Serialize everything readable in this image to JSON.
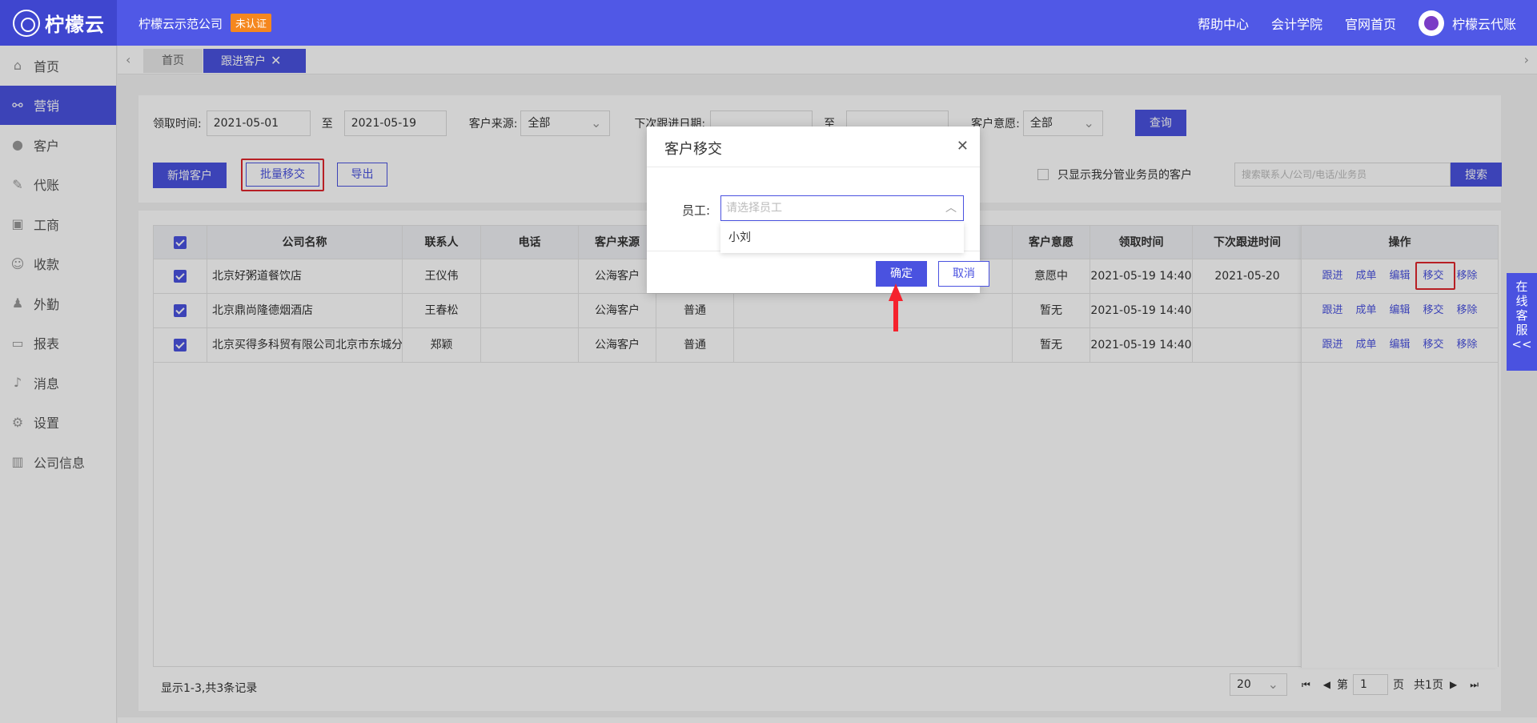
{
  "app": {
    "logo_text": "柠檬云",
    "company": "柠檬云示范公司",
    "cert_badge": "未认证"
  },
  "header": {
    "links": [
      "帮助中心",
      "会计学院",
      "官网首页"
    ],
    "user_name": "柠檬云代账"
  },
  "sidebar": {
    "items": [
      {
        "label": "首页",
        "icon": "home-icon"
      },
      {
        "label": "营销",
        "icon": "marketing-icon",
        "active": true
      },
      {
        "label": "客户",
        "icon": "customer-icon"
      },
      {
        "label": "代账",
        "icon": "bookkeeping-icon"
      },
      {
        "label": "工商",
        "icon": "business-icon"
      },
      {
        "label": "收款",
        "icon": "payment-icon"
      },
      {
        "label": "外勤",
        "icon": "field-icon"
      },
      {
        "label": "报表",
        "icon": "report-icon"
      },
      {
        "label": "消息",
        "icon": "bell-icon"
      },
      {
        "label": "设置",
        "icon": "gear-icon"
      },
      {
        "label": "公司信息",
        "icon": "building-icon"
      }
    ]
  },
  "tabs": {
    "home": "首页",
    "active": "跟进客户"
  },
  "filters": {
    "receive_time_label": "领取时间:",
    "receive_from": "2021-05-01",
    "to_1": "至",
    "receive_to": "2021-05-19",
    "source_label": "客户来源:",
    "source_value": "全部",
    "next_date_label": "下次跟进日期:",
    "to_2": "至",
    "intent_label": "客户意愿:",
    "intent_value": "全部",
    "query_btn": "查询"
  },
  "actions": {
    "add_btn": "新增客户",
    "batch_transfer_btn": "批量移交",
    "export_btn": "导出",
    "only_mine_label": "只显示我分管业务员的客户",
    "search_placeholder": "搜索联系人/公司/电话/业务员",
    "search_btn": "搜索"
  },
  "table": {
    "headers": [
      "公司名称",
      "联系人",
      "电话",
      "客户来源",
      "",
      "",
      "客户意愿",
      "领取时间",
      "下次跟进时间",
      "操作"
    ],
    "rows": [
      {
        "company": "北京好粥道餐饮店",
        "contact": "王仪伟",
        "phone": "",
        "source": "公海客户",
        "level": "",
        "intent": "意愿中",
        "time": "2021-05-19 14:40",
        "next": "2021-05-20"
      },
      {
        "company": "北京鼎尚隆德烟酒店",
        "contact": "王春松",
        "phone": "",
        "source": "公海客户",
        "level": "普通",
        "intent": "暂无",
        "time": "2021-05-19 14:40",
        "next": ""
      },
      {
        "company": "北京买得多科贸有限公司北京市东城分公",
        "contact": "郑颖",
        "phone": "",
        "source": "公海客户",
        "level": "普通",
        "intent": "暂无",
        "time": "2021-05-19 14:40",
        "next": ""
      }
    ],
    "ops": [
      "跟进",
      "成单",
      "编辑",
      "移交",
      "移除"
    ]
  },
  "footer": {
    "summary": "显示1-3,共3条记录",
    "page_size": "20",
    "page_prefix": "第",
    "page_num": "1",
    "page_suffix": "页",
    "total_pages": "共1页"
  },
  "modal": {
    "title": "客户移交",
    "employee_label": "员工:",
    "employee_placeholder": "请选择员工",
    "options": [
      "小刘"
    ],
    "ok_btn": "确定",
    "cancel_btn": "取消"
  },
  "online_service": [
    "在",
    "线",
    "客",
    "服",
    "<<"
  ],
  "colors": {
    "primary": "#4a52e0",
    "header": "#5058e6",
    "highlight": "#e0262d",
    "badge": "#f5871f"
  }
}
